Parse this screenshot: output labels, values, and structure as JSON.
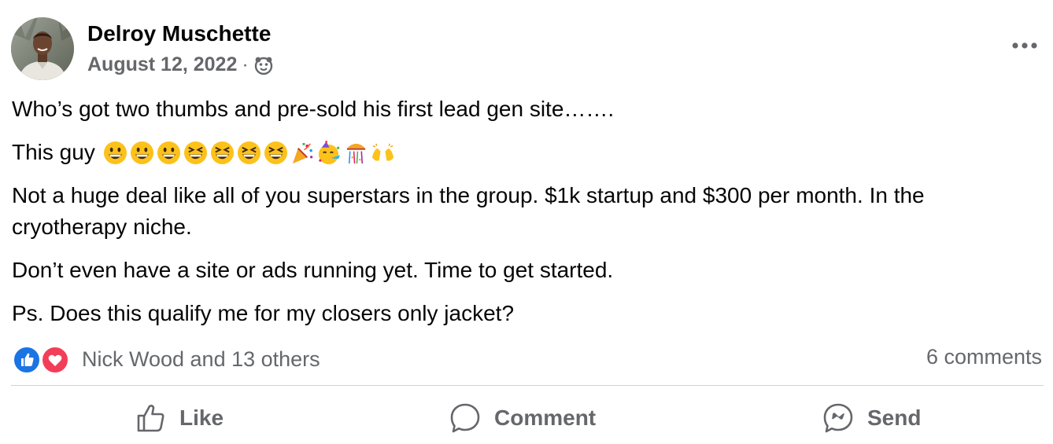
{
  "post": {
    "author": "Delroy Muschette",
    "date": "August 12, 2022",
    "separator": "·",
    "audience_icon": "public-group-icon",
    "more_icon": "more-options-icon",
    "paragraphs": [
      "Who’s got two thumbs and pre-sold his first lead gen site…….",
      "This guy",
      "Not a huge deal like all of you superstars in the group. $1k startup and $300 per month. In the cryotherapy niche.",
      "Don’t even have a site or ads running yet. Time to get started.",
      "Ps. Does this qualify me for my closers only jacket?"
    ],
    "emojis": [
      "grinning-face",
      "grinning-face",
      "grinning-face",
      "laughing-face",
      "laughing-face",
      "laughing-face",
      "laughing-face",
      "party-popper",
      "partying-face",
      "confetti-ball",
      "raising-hands"
    ]
  },
  "reactions": {
    "types": [
      "like",
      "love"
    ],
    "summary": "Nick Wood and 13 others",
    "comments": "6 comments"
  },
  "actions": {
    "like": "Like",
    "comment": "Comment",
    "send": "Send"
  },
  "colors": {
    "like_blue": "#1b74e4",
    "love_red": "#f33e58",
    "secondary_text": "#65676b"
  }
}
